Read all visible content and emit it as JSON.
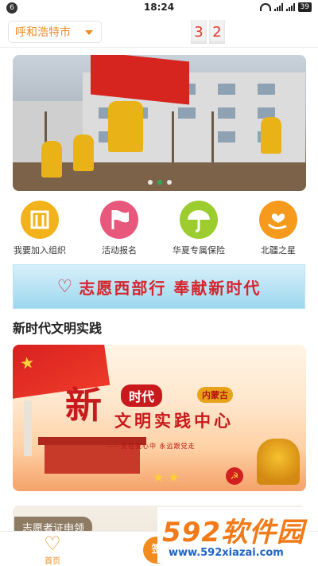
{
  "statusbar": {
    "notification_badge": "6",
    "time": "18:24",
    "battery": "39"
  },
  "header": {
    "city": "呼和浩特市",
    "counter_digits": [
      "3",
      "2"
    ]
  },
  "banner": {
    "slide_count": 3,
    "active_slide": 2
  },
  "quick_actions": [
    {
      "label": "我要加入组织",
      "icon": "organization-icon",
      "color": "#f2b21c"
    },
    {
      "label": "活动报名",
      "icon": "flag-icon",
      "color": "#e8577c"
    },
    {
      "label": "华夏专属保险",
      "icon": "umbrella-icon",
      "color": "#9ccc2e"
    },
    {
      "label": "北疆之星",
      "icon": "hand-heart-icon",
      "color": "#f59a1c"
    }
  ],
  "slogan": {
    "text": "志愿西部行 奉献新时代"
  },
  "section": {
    "title": "新时代文明实践"
  },
  "poster": {
    "big_char": "新",
    "era": "时代",
    "region": "内蒙古",
    "subtitle": "文明实践中心",
    "motto": "——党在我心中  永远跟党走"
  },
  "card": {
    "tag": "志愿者证申领"
  },
  "tabbar": {
    "home_label": "首页",
    "center_label": "签"
  },
  "watermark": {
    "brand": "592软件园",
    "url": "www.592xiazai.com"
  },
  "colors": {
    "accent": "#f28c1f",
    "slogan_red": "#d5242c"
  }
}
